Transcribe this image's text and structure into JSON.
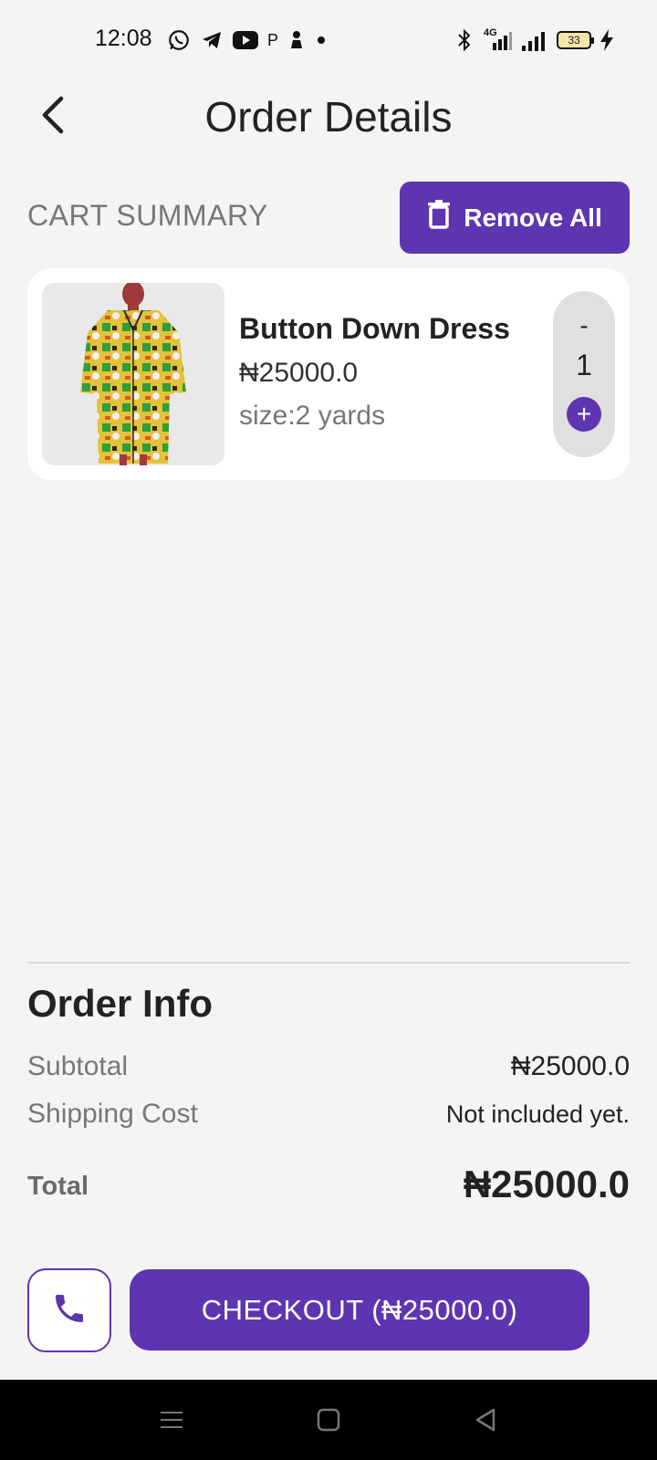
{
  "status_bar": {
    "time": "12:08",
    "left_icons": [
      "whatsapp-icon",
      "telegram-icon",
      "youtube-icon",
      "p-letter-icon",
      "chess-pawn-icon",
      "dot-icon"
    ],
    "p_letter": "P",
    "network_label": "4G",
    "battery_level": "33"
  },
  "header": {
    "title": "Order Details",
    "back_icon": "chevron-left-icon"
  },
  "cart": {
    "summary_label": "CART SUMMARY",
    "remove_all_label": "Remove All",
    "remove_all_icon": "trash-icon",
    "items": [
      {
        "name": "Button Down Dress",
        "price": "₦25000.0",
        "size": "size:2 yards",
        "quantity": "1",
        "minus_label": "-",
        "plus_label": "+"
      }
    ]
  },
  "order_info": {
    "title": "Order Info",
    "subtotal_label": "Subtotal",
    "subtotal_value": "₦25000.0",
    "shipping_label": "Shipping Cost",
    "shipping_value": "Not included yet.",
    "total_label": "Total",
    "total_value": "₦25000.0"
  },
  "actions": {
    "call_icon": "phone-icon",
    "checkout_label": "CHECKOUT (₦25000.0)"
  },
  "nav_bar": {
    "icons": [
      "menu-icon",
      "home-square-icon",
      "back-triangle-icon"
    ]
  },
  "colors": {
    "accent": "#5d35b1",
    "background": "#f4f4f4",
    "card": "#ffffff",
    "stepper": "#e0e0e0"
  }
}
